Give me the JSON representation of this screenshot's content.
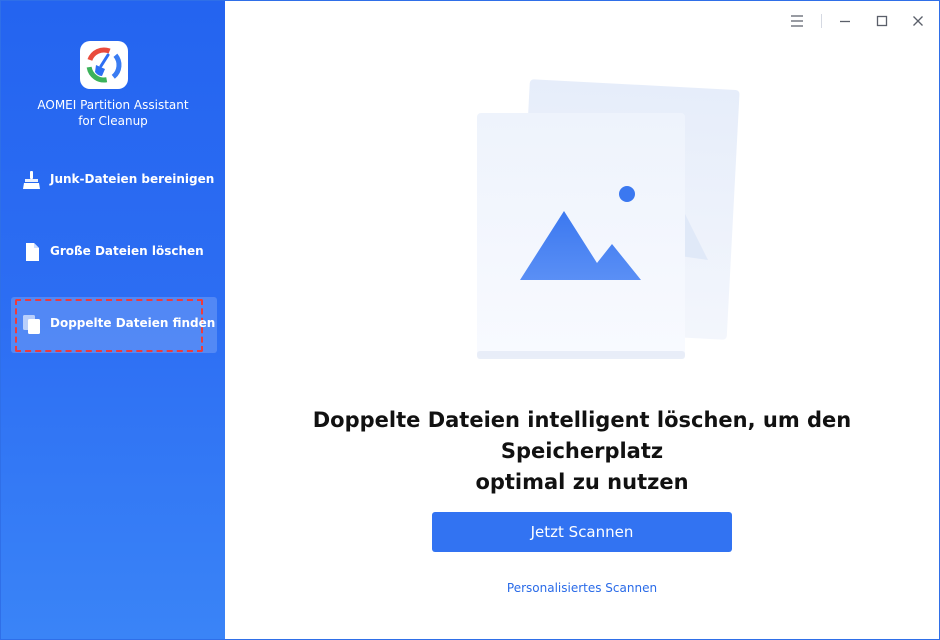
{
  "app": {
    "name_line1": "AOMEI Partition Assistant",
    "name_line2": "for Cleanup",
    "logo_icon": "cleanup-broom-logo"
  },
  "sidebar": {
    "items": [
      {
        "label": "Junk-Dateien bereinigen",
        "icon": "broom-icon",
        "active": false
      },
      {
        "label": "Große Dateien löschen",
        "icon": "file-icon",
        "active": false
      },
      {
        "label": "Doppelte Dateien finden",
        "icon": "duplicate-files-icon",
        "active": true
      }
    ]
  },
  "titlebar": {
    "controls": [
      "menu-icon",
      "minimize-icon",
      "maximize-icon",
      "close-icon"
    ]
  },
  "main": {
    "headline_line1": "Doppelte Dateien intelligent löschen, um den Speicherplatz",
    "headline_line2": "optimal zu nutzen",
    "scan_button": "Jetzt Scannen",
    "custom_scan_link": "Personalisiertes Scannen"
  },
  "colors": {
    "sidebar_blue": "#2464f0",
    "accent": "#3273f2",
    "highlight_dash": "#ef3b3b"
  }
}
